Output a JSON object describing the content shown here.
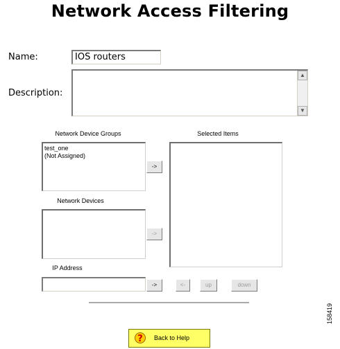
{
  "page": {
    "title": "Network Access Filtering",
    "figure_id": "158419"
  },
  "form": {
    "name_label": "Name:",
    "name_value": "IOS routers",
    "description_label": "Description:",
    "description_value": ""
  },
  "groups": {
    "label": "Network Device Groups",
    "items": [
      "test_one",
      "(Not Assigned)"
    ],
    "add_button": "->"
  },
  "devices": {
    "label": "Network Devices",
    "items": [],
    "add_button": "->"
  },
  "ip": {
    "label": "IP Address",
    "value": "",
    "add_button": "->"
  },
  "selected": {
    "label": "Selected Items",
    "items": [],
    "remove_button": "<-",
    "up_button": "up",
    "down_button": "down"
  },
  "help": {
    "label": "Back to Help"
  },
  "colors": {
    "help_button_bg": "#ffff66",
    "button_face": "#e6e6e6",
    "help_icon_red": "#cc0000"
  }
}
